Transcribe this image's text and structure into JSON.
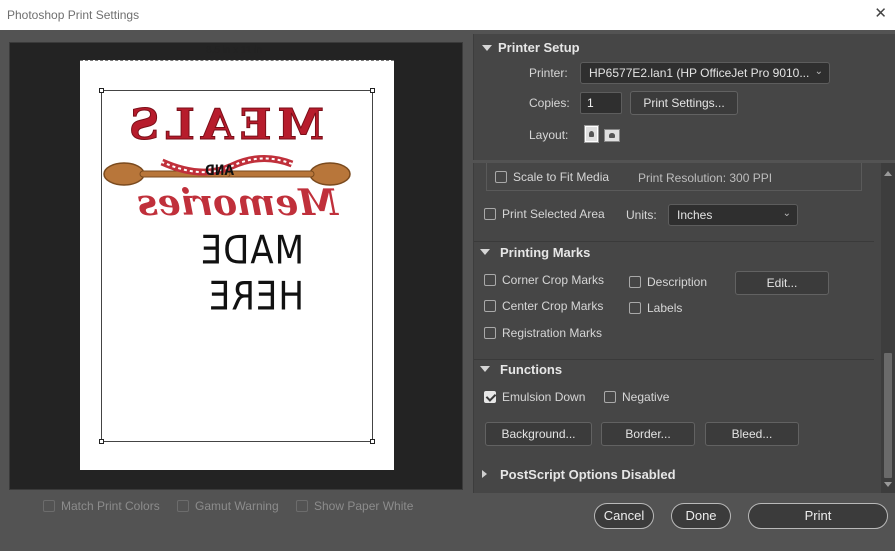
{
  "window": {
    "title": "Photoshop Print Settings",
    "close_glyph": "✕"
  },
  "preview": {
    "paper_size": "8.5 in x 11 in",
    "artwork": {
      "line1": "MEALS",
      "line2": "AND",
      "line3": "Memories",
      "line4": "MADE HERE"
    }
  },
  "preview_options": {
    "match_print_colors": "Match Print Colors",
    "gamut_warning": "Gamut Warning",
    "show_paper_white": "Show Paper White"
  },
  "printer_setup": {
    "title": "Printer Setup",
    "printer_label": "Printer:",
    "printer_value": "HP6577E2.lan1 (HP OfficeJet Pro 9010...",
    "copies_label": "Copies:",
    "copies_value": "1",
    "print_settings_button": "Print Settings...",
    "layout_label": "Layout:"
  },
  "position_size": {
    "scale_to_fit": "Scale to Fit Media",
    "print_resolution": "Print Resolution: 300 PPI",
    "print_selected_area": "Print Selected Area",
    "units_label": "Units:",
    "units_value": "Inches"
  },
  "printing_marks": {
    "title": "Printing Marks",
    "corner_crop_marks": "Corner Crop Marks",
    "center_crop_marks": "Center Crop Marks",
    "registration_marks": "Registration Marks",
    "description": "Description",
    "labels": "Labels",
    "edit_button": "Edit..."
  },
  "functions": {
    "title": "Functions",
    "emulsion_down": "Emulsion Down",
    "emulsion_down_checked": true,
    "negative": "Negative",
    "background_button": "Background...",
    "border_button": "Border...",
    "bleed_button": "Bleed..."
  },
  "postscript": {
    "title": "PostScript Options Disabled"
  },
  "footer": {
    "cancel": "Cancel",
    "done": "Done",
    "print": "Print"
  },
  "icons": {
    "select_chevron": "⌄"
  }
}
